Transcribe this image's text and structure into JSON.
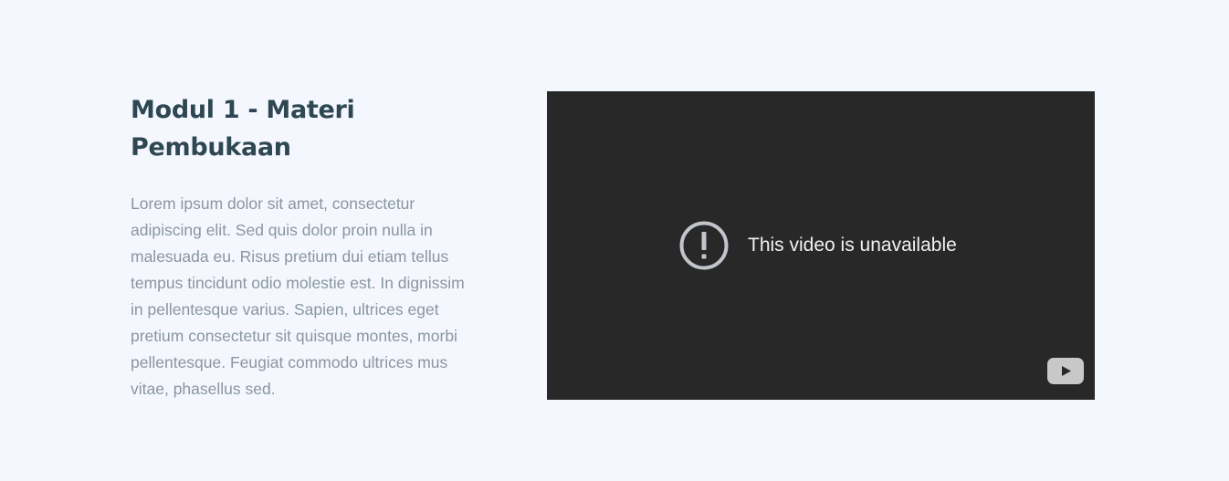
{
  "module": {
    "title": "Modul 1 - Materi Pembukaan",
    "description": "Lorem ipsum dolor sit amet, consectetur adipiscing elit. Sed quis dolor proin nulla in malesuada eu. Risus pretium dui etiam tellus tempus tincidunt odio molestie est. In dignissim in pellentesque varius. Sapien, ultrices eget pretium consectetur sit quisque montes, morbi pellentesque. Feugiat commodo ultrices mus vitae, phasellus sed."
  },
  "video": {
    "message": "This video is unavailable",
    "icons": {
      "alert": "exclamation-circle-icon",
      "logo": "youtube-logo-icon"
    }
  },
  "colors": {
    "page_background": "#f4f8fe",
    "title": "#2e4752",
    "body_text": "#8a969d",
    "video_background": "#282828",
    "video_text": "#f1f1f1",
    "icon_gray": "#c2c6cc"
  }
}
